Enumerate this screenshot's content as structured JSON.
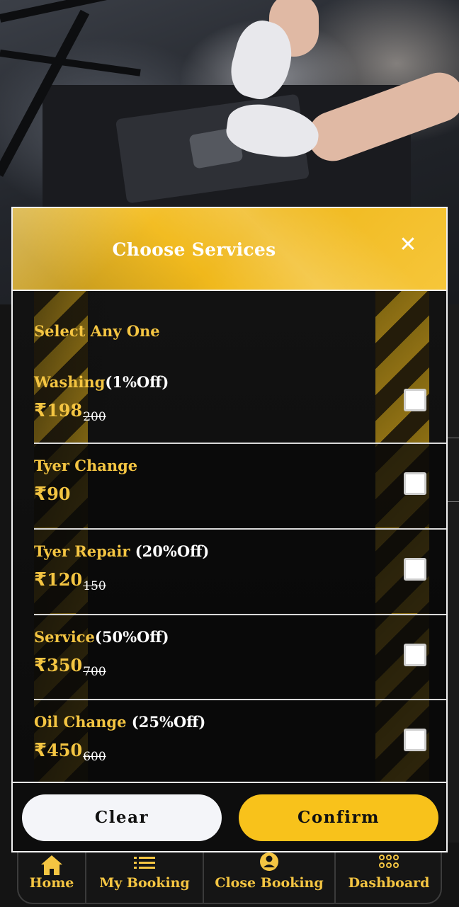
{
  "modal": {
    "title": "Choose Services",
    "close_icon": "close-icon",
    "select_label": "Select Any One",
    "services": [
      {
        "name": "Washing",
        "discount": "(1%Off)",
        "currency": "₹",
        "price": "198",
        "original_price": "200",
        "checked": false
      },
      {
        "name": "Tyer Change",
        "discount": "",
        "currency": "₹",
        "price": "90",
        "original_price": "",
        "checked": false
      },
      {
        "name": "Tyer Repair",
        "discount": " (20%Off)",
        "currency": "₹",
        "price": "120",
        "original_price": "150",
        "checked": false
      },
      {
        "name": "Service",
        "discount": "(50%Off)",
        "currency": "₹",
        "price": "350",
        "original_price": "700",
        "checked": false
      },
      {
        "name": "Oil Change",
        "discount": " (25%Off)",
        "currency": "₹",
        "price": "450",
        "original_price": "600",
        "checked": false
      }
    ],
    "clear_label": "Clear",
    "confirm_label": "Confirm"
  },
  "bottom_nav": {
    "items": [
      {
        "label": "Home",
        "icon": "home-icon"
      },
      {
        "label": "My Booking",
        "icon": "list-icon"
      },
      {
        "label": "Close Booking",
        "icon": "user-icon"
      },
      {
        "label": "Dashboard",
        "icon": "grid-icon"
      }
    ]
  },
  "colors": {
    "accent": "#f4c542",
    "confirm_button": "#f8c21b",
    "clear_button": "#f4f5f9",
    "modal_background": "#0e0e0e"
  }
}
